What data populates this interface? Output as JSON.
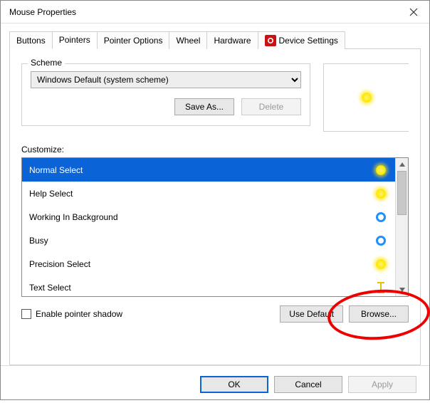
{
  "window": {
    "title": "Mouse Properties"
  },
  "tabs": {
    "buttons": "Buttons",
    "pointers": "Pointers",
    "pointer_options": "Pointer Options",
    "wheel": "Wheel",
    "hardware": "Hardware",
    "device_settings": "Device Settings"
  },
  "scheme": {
    "group_label": "Scheme",
    "selected": "Windows Default (system scheme)",
    "save_as": "Save As...",
    "delete": "Delete"
  },
  "customize": {
    "label": "Customize:",
    "items": [
      {
        "label": "Normal Select",
        "icon": "yellow-dot",
        "selected": true
      },
      {
        "label": "Help Select",
        "icon": "yellow-dot",
        "selected": false
      },
      {
        "label": "Working In Background",
        "icon": "blue-ring",
        "selected": false
      },
      {
        "label": "Busy",
        "icon": "blue-ring",
        "selected": false
      },
      {
        "label": "Precision Select",
        "icon": "yellow-dot",
        "selected": false
      },
      {
        "label": "Text Select",
        "icon": "ibeam",
        "selected": false
      }
    ]
  },
  "bottom": {
    "enable_shadow": "Enable pointer shadow",
    "use_default": "Use Default",
    "browse": "Browse..."
  },
  "dialog_buttons": {
    "ok": "OK",
    "cancel": "Cancel",
    "apply": "Apply"
  }
}
